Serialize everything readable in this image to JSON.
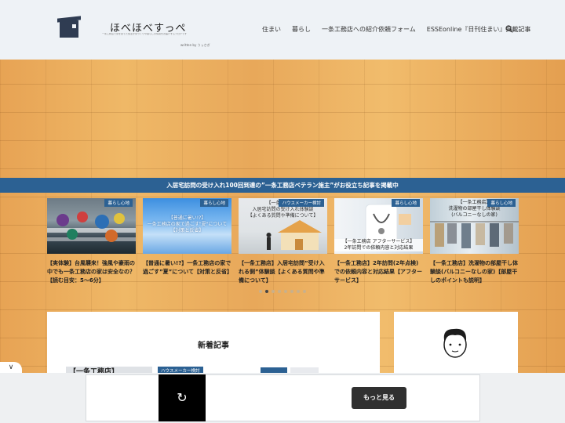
{
  "header": {
    "site_title": "ほべほべすっぺ",
    "tagline": "一条工務店で家を建てた施主が家づくりや暮らしの情報をお届けするブログです",
    "written_by": "written by うっさぎ",
    "nav": [
      "住まい",
      "暮らし",
      "一条工務店への紹介依頼フォーム",
      "ESSEonline『日刊住まい』掲載記事"
    ]
  },
  "banner": "入居宅訪問の受け入れ100回到達の”一条工務店ベテラン施主”がお役立ち記事を掲載中",
  "carousel": [
    {
      "tag": "暮らし心地",
      "title": "【実体験】台風襲来！強風や豪雨の中でも一条工務店の家は安全なの？【読む目安：5〜6分】",
      "thumb_text": ""
    },
    {
      "tag": "暮らし心地",
      "title": "【普通に暑い!?】一条工務店の家で過ごす”夏”について【対策と反省】",
      "thumb_text": "【普通に暑い!?】\n一条工務店の家で過ごす\"夏\"について\n【対策と反省】"
    },
    {
      "tag": "ハウスメーカー検討",
      "title": "【一条工務店】入居宅訪問”受け入れる側”体験談【よくある質問や準備について】",
      "thumb_text": "【一条工務店】\n入居宅訪問の受け入れ体験談\n【よくある質問や準備について】"
    },
    {
      "tag": "暮らし心地",
      "title": "【一条工務店】2年訪問(2年点検)での依頼内容と対応結果【アフターサービス】",
      "thumb_text": "【一条工務店 アフターサービス】\n2年訪問での依頼内容と対応結果"
    },
    {
      "tag": "暮らし心地",
      "title": "【一条工務店】洗濯物の部屋干し体験談(バルコニーなしの家)【部屋干しのポイントも説明】",
      "thumb_text": "【一条工務店】\n洗濯物の部屋干し体験談\n(バルコニーなしの家)"
    }
  ],
  "main": {
    "section_title": "新着記事",
    "article_thumb_text": "【一条工務店】",
    "article_tag": "ハウスメーカー検討"
  },
  "ad": {
    "replay_icon": "↻",
    "more_label": "もっと見る"
  },
  "collapse_icon": "∨"
}
